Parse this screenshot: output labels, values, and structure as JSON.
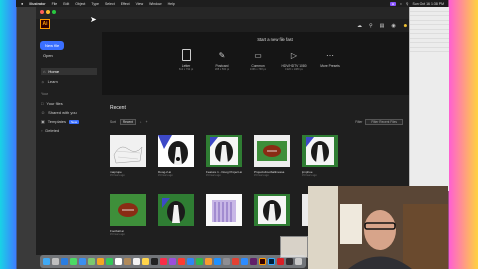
{
  "menubar": {
    "app": "Illustrator",
    "items": [
      "File",
      "Edit",
      "Object",
      "Type",
      "Select",
      "Effect",
      "View",
      "Window",
      "Help"
    ],
    "clock": "Sun Oct 16  1:38 PM"
  },
  "app": {
    "logo": "Ai",
    "traffic_colors": [
      "#ff5f57",
      "#febc2e",
      "#28c840"
    ]
  },
  "sidebar": {
    "new_file": "New file",
    "open": "Open",
    "home": "Home",
    "learn": "Learn",
    "section_your": "Your",
    "your_files": "Your files",
    "shared_with_you": "Shared with you",
    "templates": "Templates",
    "templates_badge": "New",
    "deleted": "Deleted"
  },
  "new_file_panel": {
    "title": "Start a new file fast",
    "items": [
      {
        "name": "Letter",
        "dim": "612 x 792 pt"
      },
      {
        "name": "Postcard",
        "dim": "288 x 560 pt"
      },
      {
        "name": "Common",
        "dim": "1366 x 768 px"
      },
      {
        "name": "HDV/HDTV 1080",
        "dim": "1920 x 1080 px"
      },
      {
        "name": "More Presets",
        "dim": ""
      }
    ]
  },
  "recent": {
    "title": "Recent",
    "sort_label": "Sort",
    "sort_value": "Recent",
    "filter_label": "Filter",
    "filter_placeholder": "Filter Recent Files",
    "files": [
      {
        "name": "maprupe",
        "date": "15 hours ago"
      },
      {
        "name": "Doog-2.ai",
        "date": "15 hours ago"
      },
      {
        "name": "Feature 1 - Doog Project.ai",
        "date": "15 hours ago"
      },
      {
        "name": "ProjectsFootballmessa",
        "date": "15 hours ago"
      },
      {
        "name": "jimphoe",
        "date": "15 hours ago"
      },
      {
        "name": "Football.ai",
        "date": "15 hours ago"
      },
      {
        "name": "",
        "date": ""
      },
      {
        "name": "",
        "date": ""
      },
      {
        "name": "",
        "date": ""
      },
      {
        "name": "",
        "date": ""
      }
    ]
  }
}
